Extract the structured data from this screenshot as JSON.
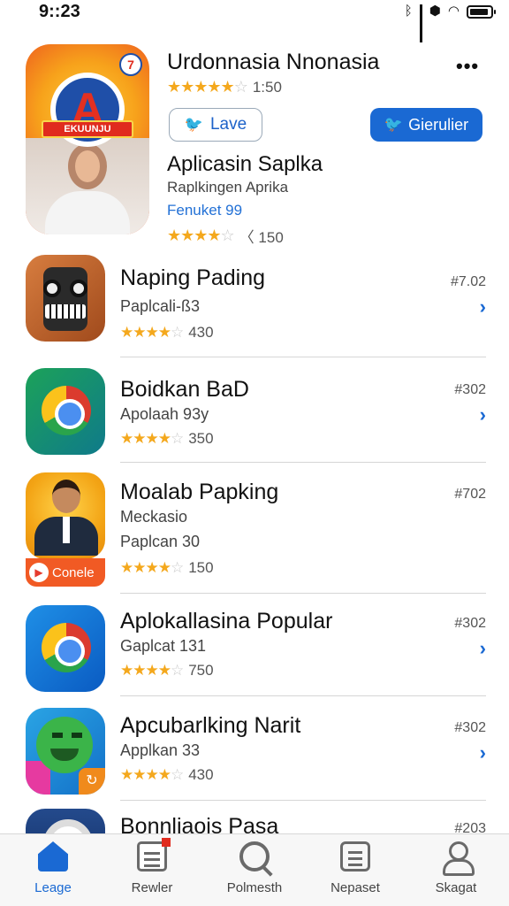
{
  "status_bar": {
    "time": "9::23"
  },
  "featured": {
    "title": "Urdonnasia Nnonasia",
    "rating_count": "1:50",
    "stars_filled": 4.5,
    "love_button": "Lave",
    "follow_button": "Gierulier",
    "subtitle": "Aplicasin Saplka",
    "developer": "Raplkingen Aprika",
    "link_text": "Fenuket 99",
    "rating2_count": "150",
    "rating2_stars": 4,
    "badge_ribbon": "EKUUNJU",
    "badge_letter": "A"
  },
  "apps": [
    {
      "name": "Naping Pading",
      "sub": "Paplcali-ß3",
      "rating_count": "430",
      "rank": "#7.02",
      "stars": 4
    },
    {
      "name": "Boidkan BaD",
      "sub": "Apolaah 93y",
      "rating_count": "350",
      "rank": "#302",
      "stars": 4
    },
    {
      "name": "Moalab Papking",
      "sub": "Meckasio",
      "sub2": "Paplcan 30",
      "rating_count": "150",
      "rank": "#702",
      "stars": 4,
      "badge": "Conele"
    },
    {
      "name": "Aplokallasina Popular",
      "sub": "Gaplcat 131",
      "rating_count": "750",
      "rank": "#302",
      "stars": 4
    },
    {
      "name": "Apcubarlking Narit",
      "sub": "Applkan 33",
      "rating_count": "430",
      "rank": "#302",
      "stars": 4
    },
    {
      "name": "Bonnliaois Pasa",
      "rank": "#203"
    }
  ],
  "tabs": [
    {
      "label": "Leage",
      "icon": "home-icon",
      "active": true
    },
    {
      "label": "Rewler",
      "icon": "news-icon",
      "active": false
    },
    {
      "label": "Polmesth",
      "icon": "search-icon",
      "active": false
    },
    {
      "label": "Nepaset",
      "icon": "apps-icon",
      "active": false
    },
    {
      "label": "Skagat",
      "icon": "user-icon",
      "active": false
    }
  ],
  "colors": {
    "accent": "#1a69d3",
    "star": "#f4a81d",
    "notification": "#e02b1e"
  }
}
